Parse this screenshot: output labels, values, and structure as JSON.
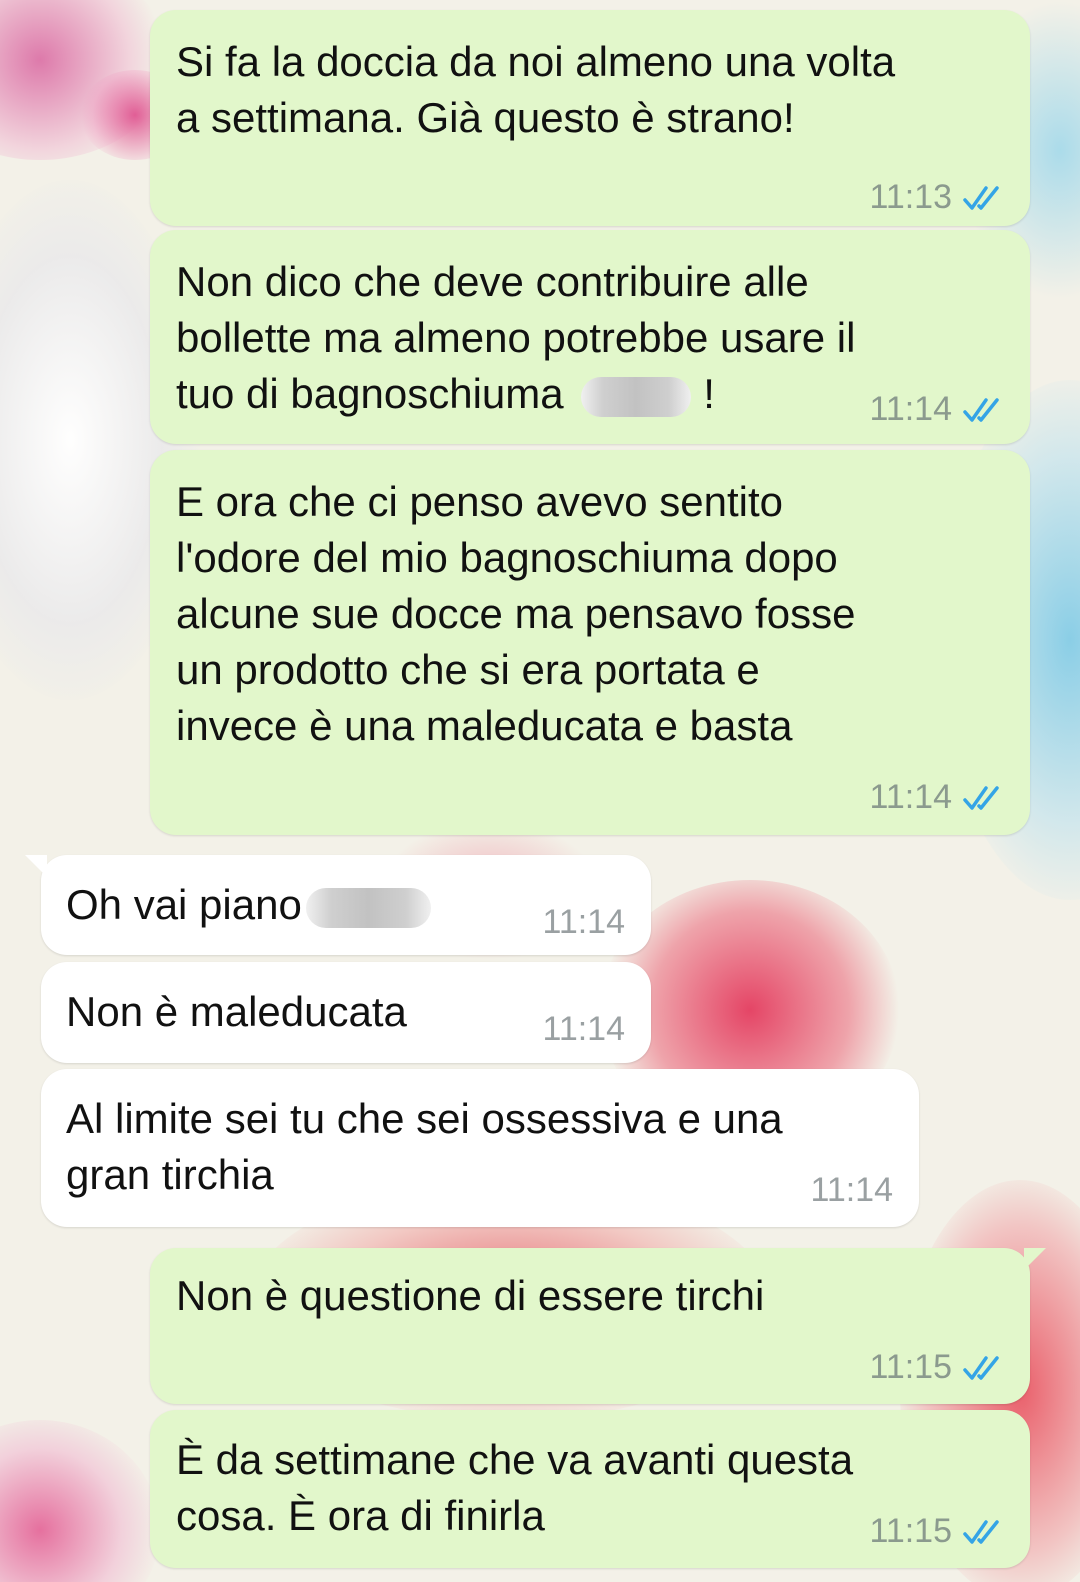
{
  "colors": {
    "outgoing_bubble": "#e2f7cb",
    "incoming_bubble": "#ffffff",
    "read_ticks": "#34a4e6",
    "timestamp": "#8b9a8e"
  },
  "messages": [
    {
      "direction": "outgoing",
      "text": "Si fa la doccia da noi almeno una volta\na settimana. Già questo è strano!",
      "time": "11:13",
      "status": "read"
    },
    {
      "direction": "outgoing",
      "text_before": "Non dico che deve contribuire alle\nbollette ma almeno potrebbe usare il\ntuo di bagnoschiuma ",
      "text_after": "!",
      "redacted": true,
      "time": "11:14",
      "status": "read"
    },
    {
      "direction": "outgoing",
      "text": "E ora che ci penso avevo sentito\nl'odore del mio bagnoschiuma dopo\nalcune sue docce ma pensavo fosse\nun prodotto che si era portata e\ninvece è una maleducata e basta",
      "time": "11:14",
      "status": "read"
    },
    {
      "direction": "incoming",
      "text": "Oh vai piano",
      "redacted": true,
      "time": "11:14"
    },
    {
      "direction": "incoming",
      "text": "Non è maleducata",
      "time": "11:14"
    },
    {
      "direction": "incoming",
      "text": "Al limite sei tu che sei ossessiva e una\ngran tirchia",
      "time": "11:14"
    },
    {
      "direction": "outgoing",
      "text": "Non è questione di essere tirchi",
      "time": "11:15",
      "status": "read"
    },
    {
      "direction": "outgoing",
      "text": "È da settimane che va avanti questa\ncosa. È ora di finirla",
      "time": "11:15",
      "status": "read"
    }
  ]
}
